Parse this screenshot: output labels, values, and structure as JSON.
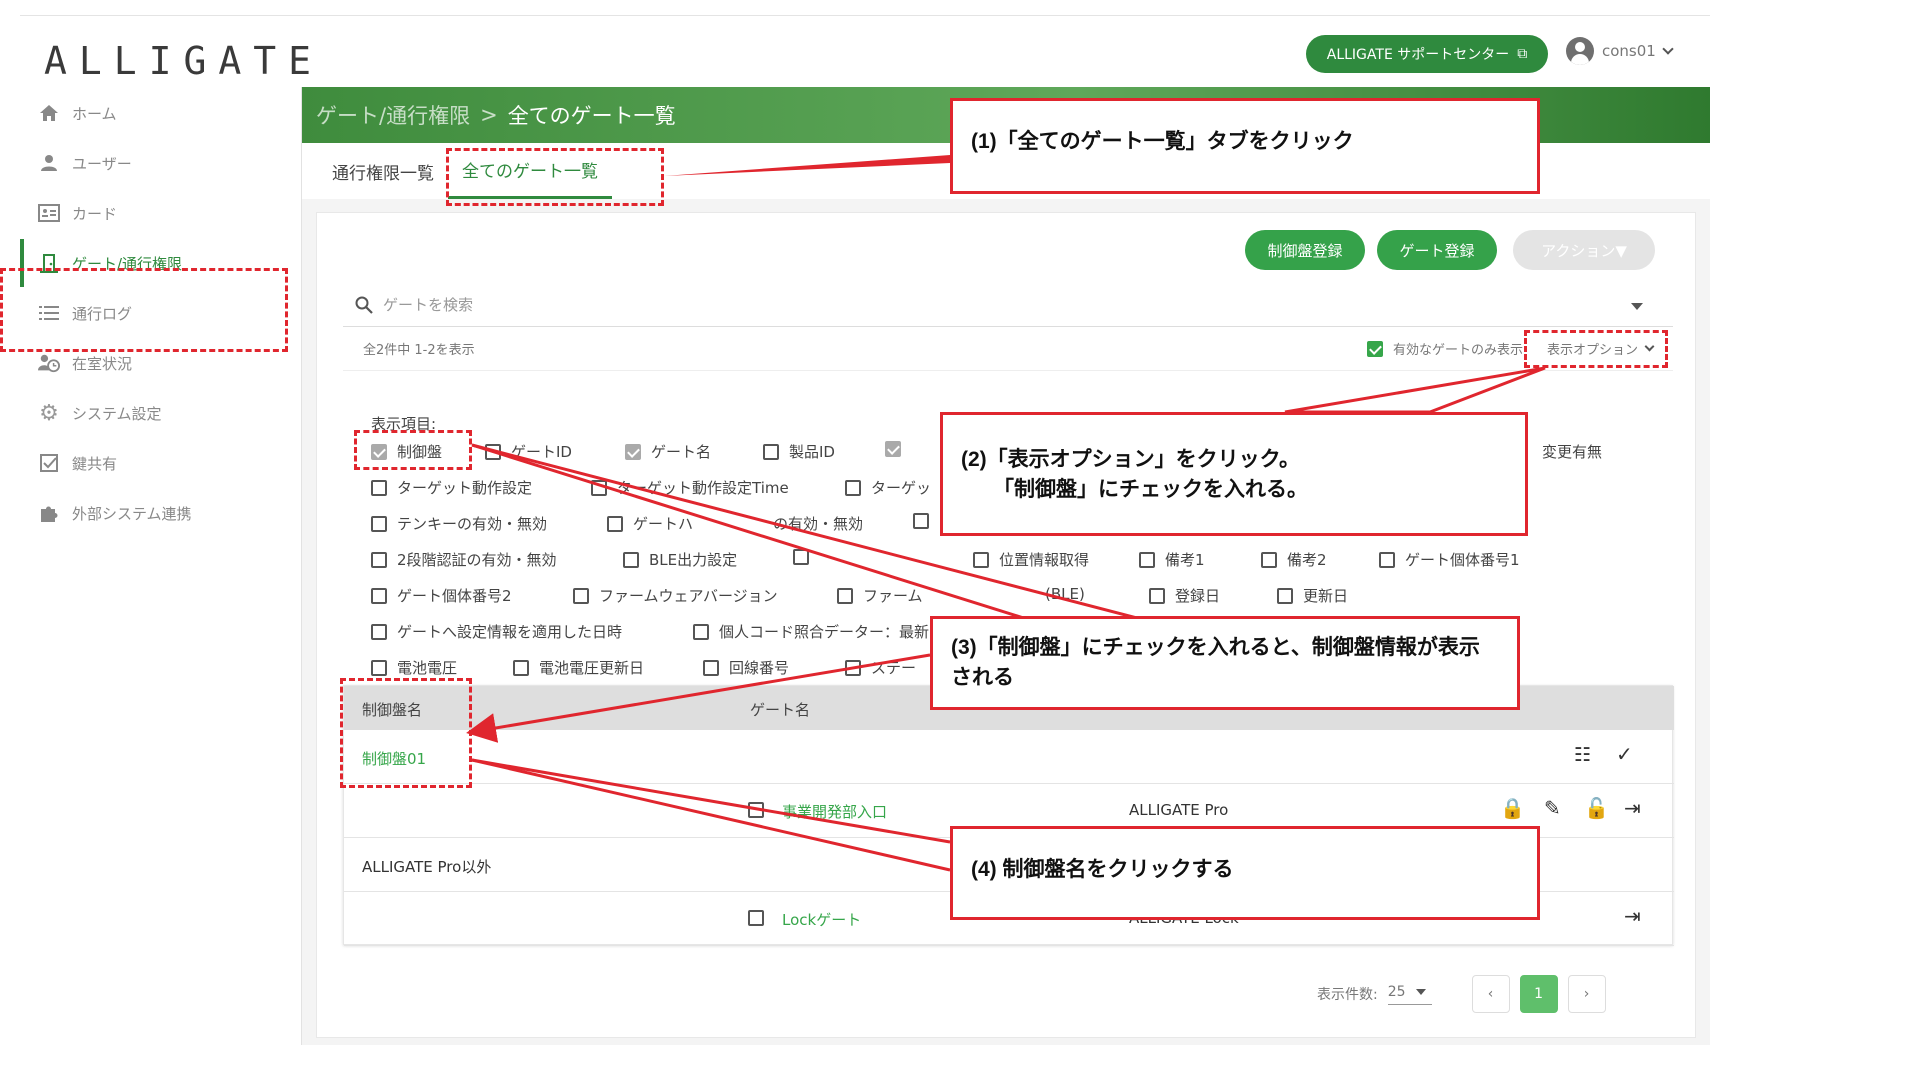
{
  "header": {
    "logo": "ALLIGATE",
    "support_label": "ALLIGATE サポートセンター",
    "user_name": "cons01"
  },
  "sidebar": {
    "items": [
      {
        "label": "ホーム",
        "icon": "home-icon"
      },
      {
        "label": "ユーザー",
        "icon": "person-icon"
      },
      {
        "label": "カード",
        "icon": "id-card-icon"
      },
      {
        "label": "ゲート/通行権限",
        "icon": "door-icon"
      },
      {
        "label": "通行ログ",
        "icon": "list-icon"
      },
      {
        "label": "在室状況",
        "icon": "person-clock-icon"
      },
      {
        "label": "システム設定",
        "icon": "gear-icon"
      },
      {
        "label": "鍵共有",
        "icon": "checkbox-icon"
      },
      {
        "label": "外部システム連携",
        "icon": "puzzle-icon"
      }
    ]
  },
  "breadcrumb": {
    "parent": "ゲート/通行権限",
    "separator": ">",
    "current": "全てのゲート一覧"
  },
  "tabs": [
    "通行権限一覧",
    "全てのゲート一覧"
  ],
  "toolbar": {
    "controller_register": "制御盤登録",
    "gate_register": "ゲート登録",
    "action": "アクション▼"
  },
  "search": {
    "placeholder": "ゲートを検索"
  },
  "meta": {
    "count_text": "全2件中 1-2を表示",
    "active_only": "有効なゲートのみ表示",
    "display_options": "表示オプション"
  },
  "display_items_label": "表示項目:",
  "display_options": [
    {
      "label": "制御盤",
      "checked": true
    },
    {
      "label": "ゲートID",
      "checked": false
    },
    {
      "label": "ゲート名",
      "checked": true
    },
    {
      "label": "製品ID",
      "checked": false
    },
    {
      "label": "",
      "checked": true
    },
    {
      "label": "変更有無",
      "checked": null
    },
    {
      "label": "ターゲット動作設定",
      "checked": false
    },
    {
      "label": "ターゲット動作設定Time",
      "checked": false
    },
    {
      "label": "ターゲッ",
      "checked": false
    },
    {
      "label": "テンキーの有効・無効",
      "checked": false
    },
    {
      "label": "ゲートハ",
      "checked": false
    },
    {
      "label": "の有効・無効",
      "checked": null
    },
    {
      "label": "",
      "checked": false
    },
    {
      "label": "2段階認証の有効・無効",
      "checked": false
    },
    {
      "label": "BLE出力設定",
      "checked": false
    },
    {
      "label": "",
      "checked": false
    },
    {
      "label": "位置情報取得",
      "checked": false
    },
    {
      "label": "備考1",
      "checked": false
    },
    {
      "label": "備考2",
      "checked": false
    },
    {
      "label": "ゲート個体番号1",
      "checked": false
    },
    {
      "label": "ゲート個体番号2",
      "checked": false
    },
    {
      "label": "ファームウェアバージョン",
      "checked": false
    },
    {
      "label": "ファーム",
      "checked": false
    },
    {
      "label": "(BLE)",
      "checked": null
    },
    {
      "label": "登録日",
      "checked": false
    },
    {
      "label": "更新日",
      "checked": false
    },
    {
      "label": "ゲートへ設定情報を適用した日時",
      "checked": false
    },
    {
      "label": "個人コード照合データー：最新",
      "checked": false
    },
    {
      "label": "電池電圧",
      "checked": false
    },
    {
      "label": "電池電圧更新日",
      "checked": false
    },
    {
      "label": "回線番号",
      "checked": false
    },
    {
      "label": "ステー",
      "checked": false
    }
  ],
  "table": {
    "headers": [
      "制御盤名",
      "ゲート名"
    ],
    "groups": [
      {
        "controller": "制御盤01",
        "gate": "事業開発部入口",
        "product": "ALLIGATE Pro"
      },
      {
        "controller": "ALLIGATE Pro以外",
        "gate": "Lockゲート",
        "product": "ALLIGATE Lock"
      }
    ]
  },
  "pagination": {
    "per_page_label": "表示件数:",
    "per_page": "25",
    "current_page": "1"
  },
  "callouts": [
    "(1)「全てのゲート一覧」タブをクリック",
    "(2)「表示オプション」をクリック。",
    "「制御盤」にチェックを入れる。",
    "(3)「制御盤」にチェックを入れると、制御盤情報が表示される",
    "(4) 制御盤名をクリックする"
  ],
  "colors": {
    "accent": "#2f8a3e",
    "annotation": "#e0262e"
  }
}
